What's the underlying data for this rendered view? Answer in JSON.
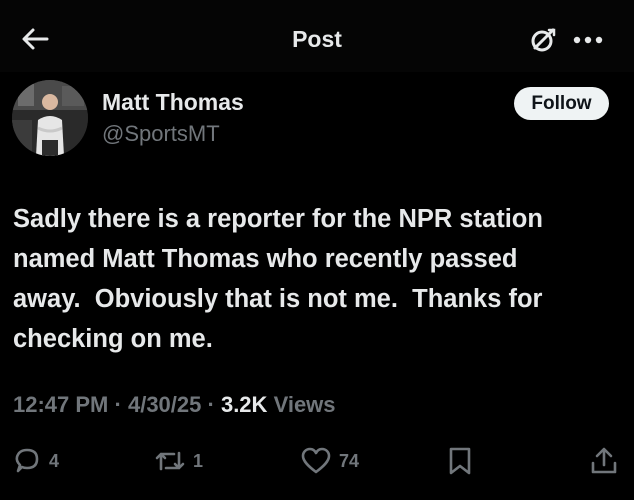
{
  "header": {
    "title": "Post",
    "icons": {
      "back": "arrow-left-icon",
      "grok": "grok-icon",
      "more": "more-icon"
    }
  },
  "author": {
    "name": "Matt Thomas",
    "handle": "@SportsMT",
    "follow_label": "Follow"
  },
  "post": {
    "text": "Sadly there is a reporter for the NPR station\nnamed Matt Thomas who recently passed\naway.  Obviously that is not me.  Thanks for\nchecking on me.",
    "time": "12:47 PM",
    "date": "4/30/25",
    "separator": "·",
    "views_count": "3.2K",
    "views_label": "Views"
  },
  "actions": {
    "replies": "4",
    "reposts": "1",
    "likes": "74"
  },
  "colors": {
    "background": "#000000",
    "text_primary": "#e7e9ea",
    "text_secondary": "#71767b",
    "follow_bg": "#eff3f4"
  }
}
